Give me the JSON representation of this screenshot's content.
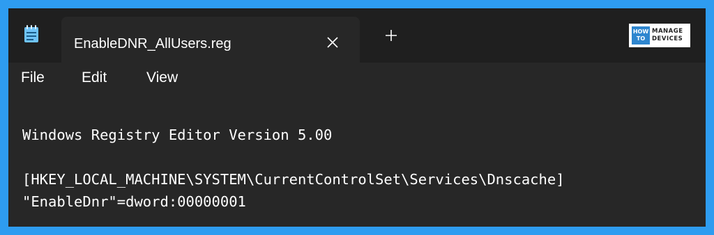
{
  "window": {
    "tab_title": "EnableDNR_AllUsers.reg",
    "app_icon": "notepad-icon",
    "close_icon": "close-icon",
    "new_tab_icon": "plus-icon"
  },
  "logo": {
    "left_top": "HOW",
    "left_bottom": "TO",
    "right_top": "MANAGE",
    "right_bottom": "DEVICES"
  },
  "menu": {
    "file": "File",
    "edit": "Edit",
    "view": "View"
  },
  "editor": {
    "lines": [
      "Windows Registry Editor Version 5.00",
      "",
      "[HKEY_LOCAL_MACHINE\\SYSTEM\\CurrentControlSet\\Services\\Dnscache]",
      "\"EnableDnr\"=dword:00000001"
    ]
  },
  "colors": {
    "border": "#2e9cf0",
    "titlebar": "#1f1f1f",
    "surface": "#272727",
    "text": "#ffffff"
  }
}
